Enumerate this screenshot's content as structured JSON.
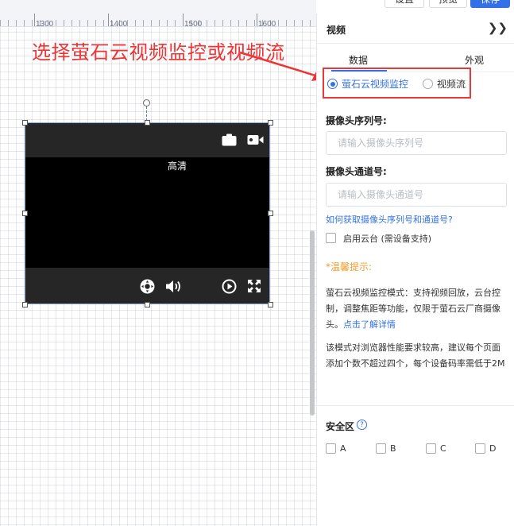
{
  "ruler": {
    "ticks": [
      "1300",
      "1400",
      "1500",
      "1600"
    ]
  },
  "annotation": {
    "text": "选择萤石云视频监控或视频流",
    "color": "#ee3434"
  },
  "top_buttons": {
    "reset": "设置",
    "preview": "预览",
    "save": "保存"
  },
  "video_widget": {
    "quality_label": "高清"
  },
  "panel": {
    "title": "视频",
    "collapse_icon": "double-chevron-right-icon",
    "tabs": [
      "数据",
      "外观"
    ],
    "active_tab": "数据",
    "source_options": [
      {
        "label": "萤石云视频监控",
        "selected": true
      },
      {
        "label": "视频流",
        "selected": false
      }
    ],
    "serial_label": "摄像头序列号:",
    "serial_placeholder": "请输入摄像头序列号",
    "channel_label": "摄像头通道号:",
    "channel_placeholder": "请输入摄像头通道号",
    "help_link": "如何获取摄像头序列号和通道号?",
    "ptz_label": "启用云台 (需设备支持)",
    "tip_title": "*温馨提示:",
    "tip1": "萤石云视频监控模式：支持视频回放，云台控制，调整焦距等功能，仅限于萤石云厂商摄像头。",
    "tip1_link": "点击了解详情",
    "tip2": "该模式对浏览器性能要求较高，建议每个页面添加个数不超过四个，每个设备码率需低于2M",
    "safe_zone_label": "安全区",
    "safe_zones": [
      "A",
      "B",
      "C",
      "D"
    ]
  },
  "colors": {
    "accent": "#3471e8",
    "annotation": "#ee3434",
    "warning": "#f19d2f"
  }
}
